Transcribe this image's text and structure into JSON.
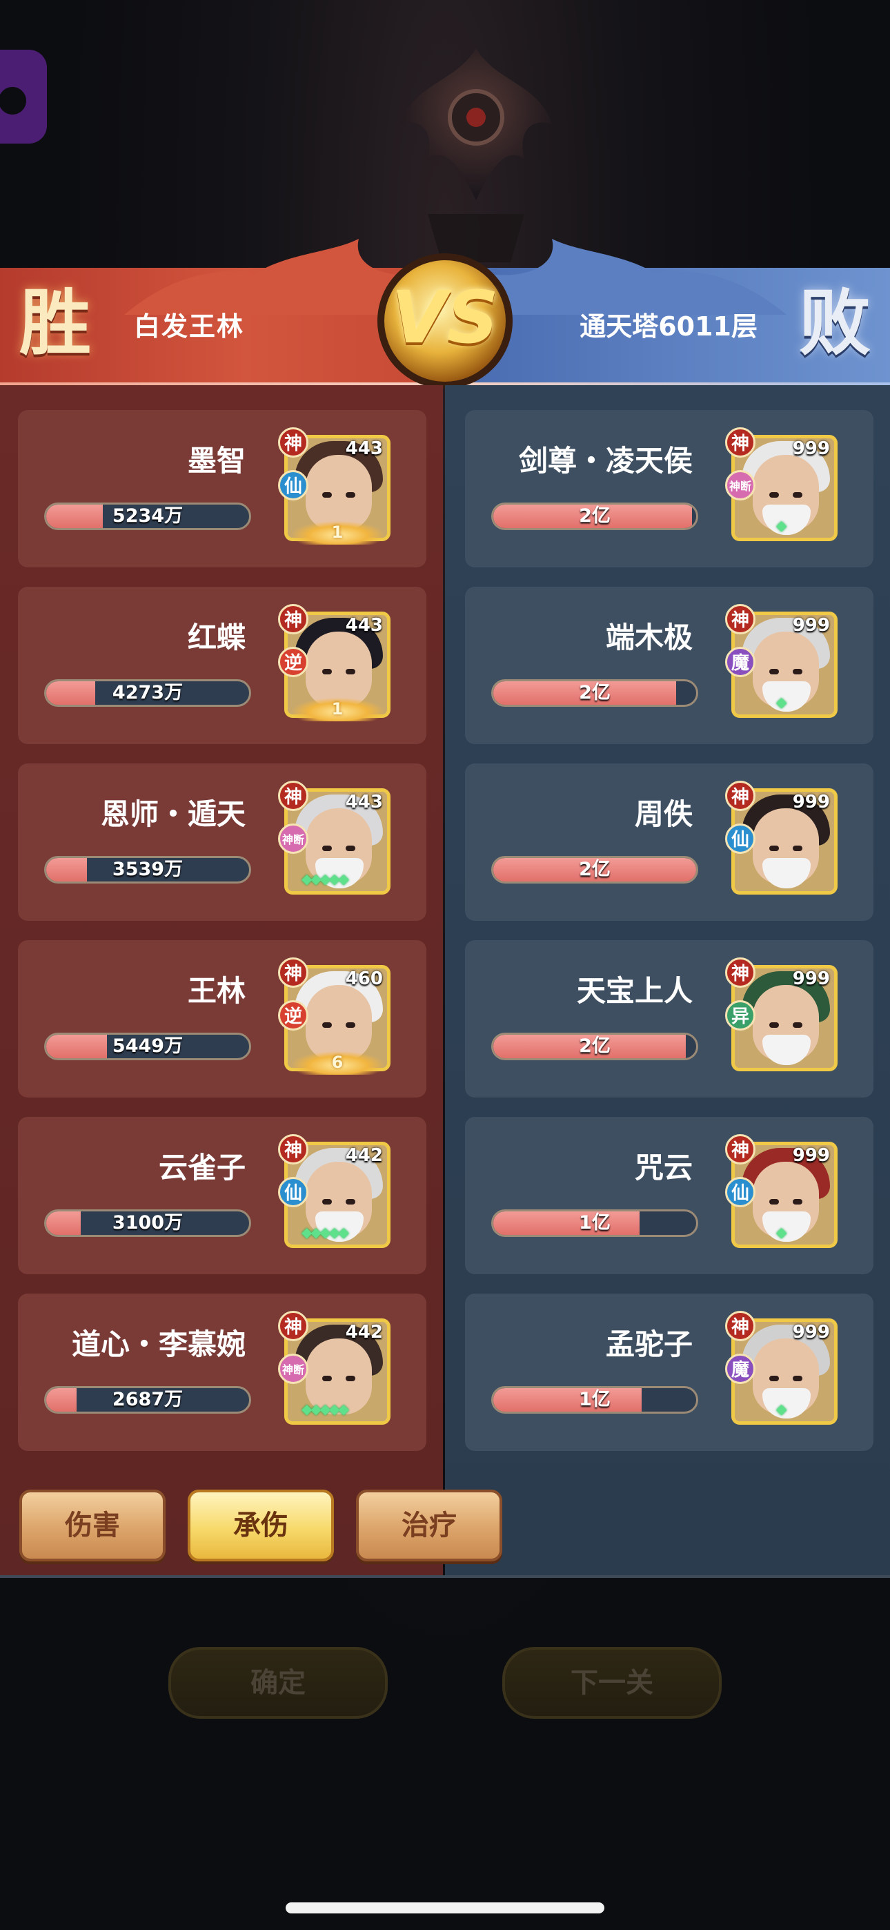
{
  "header": {
    "win_label": "胜",
    "lose_label": "败",
    "vs_label": "VS",
    "left_team": "白发王林",
    "right_team": "通天塔6011层"
  },
  "colors": {
    "win_red": "#c64a35",
    "lose_blue": "#5b7fc0",
    "hp_bar": "#e2706a",
    "frame_gold": "#f0c947"
  },
  "left_heroes": [
    {
      "name": "墨智",
      "value": "5234万",
      "fill": 0.28,
      "god_badge": "神",
      "faction": "仙",
      "level": "443",
      "bottom": "wings",
      "wing_num": "1"
    },
    {
      "name": "红蝶",
      "value": "4273万",
      "fill": 0.24,
      "god_badge": "神",
      "faction": "逆",
      "level": "443",
      "bottom": "wings",
      "wing_num": "1"
    },
    {
      "name": "恩师・遁天",
      "value": "3539万",
      "fill": 0.2,
      "god_badge": "神",
      "faction": "神断",
      "level": "443",
      "bottom": "stars"
    },
    {
      "name": "王林",
      "value": "5449万",
      "fill": 0.3,
      "god_badge": "神",
      "faction": "逆",
      "level": "460",
      "bottom": "wings",
      "wing_num": "6"
    },
    {
      "name": "云雀子",
      "value": "3100万",
      "fill": 0.17,
      "god_badge": "神",
      "faction": "仙",
      "level": "442",
      "bottom": "stars"
    },
    {
      "name": "道心・李慕婉",
      "value": "2687万",
      "fill": 0.15,
      "god_badge": "神",
      "faction": "神断",
      "level": "442",
      "bottom": "stars"
    }
  ],
  "right_heroes": [
    {
      "name": "剑尊・凌天侯",
      "value": "2亿",
      "fill": 0.98,
      "god_badge": "神",
      "faction": "神断",
      "level": "999",
      "bottom": "gem"
    },
    {
      "name": "端木极",
      "value": "2亿",
      "fill": 0.9,
      "god_badge": "神",
      "faction": "魔",
      "level": "999",
      "bottom": "gem"
    },
    {
      "name": "周佚",
      "value": "2亿",
      "fill": 1.0,
      "god_badge": "神",
      "faction": "仙",
      "level": "999",
      "bottom": "none"
    },
    {
      "name": "天宝上人",
      "value": "2亿",
      "fill": 0.95,
      "god_badge": "神",
      "faction": "异",
      "level": "999",
      "bottom": "none"
    },
    {
      "name": "咒云",
      "value": "1亿",
      "fill": 0.72,
      "god_badge": "神",
      "faction": "仙",
      "level": "999",
      "bottom": "gem"
    },
    {
      "name": "孟驼子",
      "value": "1亿",
      "fill": 0.73,
      "god_badge": "神",
      "faction": "魔",
      "level": "999",
      "bottom": "gem"
    }
  ],
  "tabs": [
    {
      "label": "伤害",
      "active": false
    },
    {
      "label": "承伤",
      "active": true
    },
    {
      "label": "治疗",
      "active": false
    }
  ],
  "actions": {
    "confirm": "确定",
    "next": "下一关"
  }
}
